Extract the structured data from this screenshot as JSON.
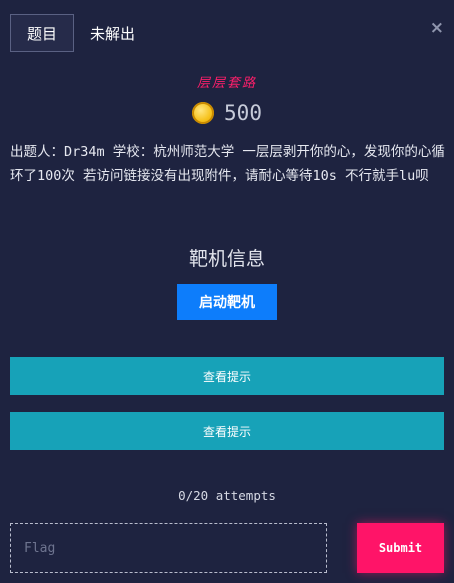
{
  "tabs": [
    {
      "label": "题目",
      "active": true
    },
    {
      "label": "未解出",
      "active": false
    }
  ],
  "close_icon": "×",
  "challenge": {
    "name": "层层套路",
    "points": "500",
    "description": "出题人：Dr34m 学校：杭州师范大学 一层层剥开你的心，发现你的心循环了100次 若访问链接没有出现附件，请耐心等待10s 不行就手lu呗"
  },
  "target": {
    "title": "靶机信息",
    "start_label": "启动靶机"
  },
  "hints": [
    "查看提示",
    "查看提示"
  ],
  "attempts": "0/20 attempts",
  "flag": {
    "placeholder": "Flag",
    "value": ""
  },
  "submit_label": "Submit",
  "colors": {
    "background": "#1e2340",
    "accent": "#ff1468",
    "primary": "#0d7dfb",
    "hint": "#17a2b8"
  }
}
